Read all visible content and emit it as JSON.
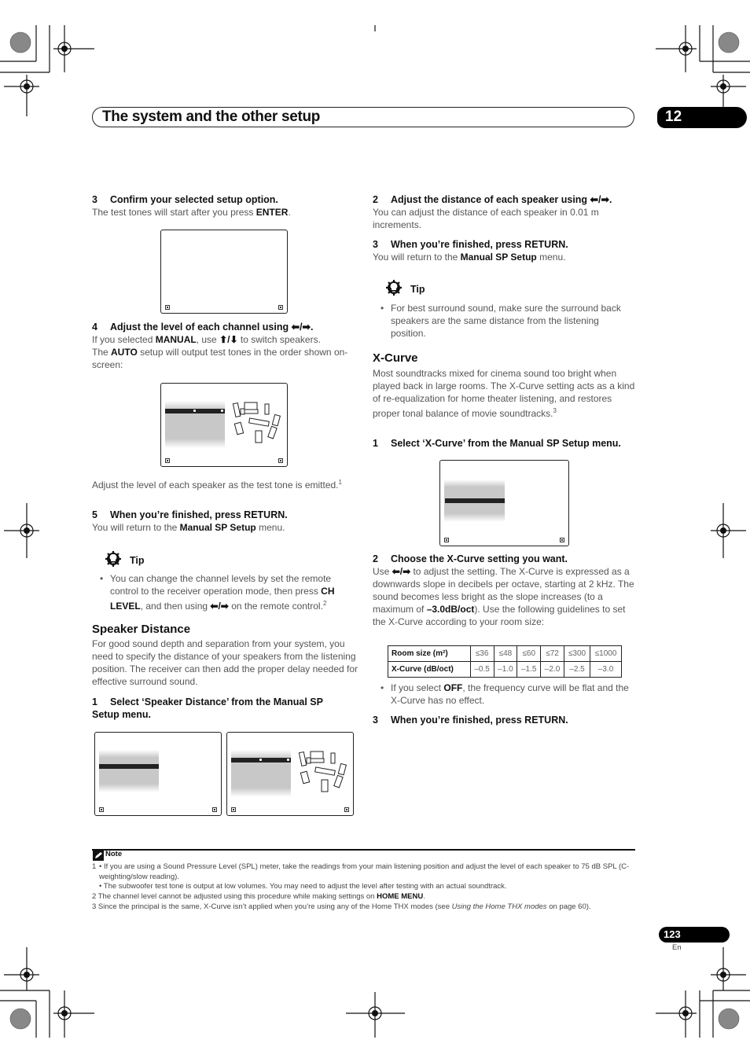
{
  "header": {
    "title": "The system and the other setup",
    "chapter_number": "12"
  },
  "left_column": {
    "step3": {
      "num": "3",
      "title": "Confirm your selected setup option.",
      "body_pre": "The test tones will start after you press ",
      "body_bold": "ENTER",
      "body_post": "."
    },
    "step4": {
      "num": "4",
      "title": "Adjust the level of each channel using ⬅/➡.",
      "line1_pre": "If you selected ",
      "line1_bold": "MANUAL",
      "line1_mid": ", use ",
      "line1_arrows": "⬆/⬇",
      "line1_post": " to switch speakers.",
      "line2_pre": "The ",
      "line2_bold": "AUTO",
      "line2_post": " setup will output test tones in the order shown on-screen:"
    },
    "adjust_text": "Adjust the level of each speaker as the test tone is emitted.",
    "adjust_sup": "1",
    "step5": {
      "num": "5",
      "title": "When you’re finished, press RETURN.",
      "body_pre": "You will return to the ",
      "body_bold": "Manual SP Setup",
      "body_post": " menu."
    },
    "tip": {
      "label": "Tip",
      "bullet": "•",
      "text_pre": "You can change the channel levels by set the remote control to the receiver operation mode, then press ",
      "text_bold1": "CH LEVEL",
      "text_mid": ", and then using ",
      "text_arrows": "⬅/➡",
      "text_post": " on the remote control.",
      "sup": "2"
    },
    "speaker_distance": {
      "heading": "Speaker Distance",
      "body": "For good sound depth and separation from your system, you need to specify the distance of your speakers from the listening position. The receiver can then add the proper delay needed for effective surround sound.",
      "step1_num": "1",
      "step1_title": "Select ‘Speaker Distance’ from the Manual SP Setup menu."
    }
  },
  "right_column": {
    "step2": {
      "num": "2",
      "title": "Adjust the distance of each speaker using ⬅/➡.",
      "body": "You can adjust the distance of each speaker in 0.01 m increments."
    },
    "step3": {
      "num": "3",
      "title": "When you’re finished, press RETURN.",
      "body_pre": "You will return to the ",
      "body_bold": "Manual SP Setup",
      "body_post": " menu."
    },
    "tip": {
      "label": "Tip",
      "bullet": "•",
      "text": "For best surround sound, make sure the surround back speakers are the same distance from the listening position."
    },
    "xcurve": {
      "heading": "X-Curve",
      "body": "Most soundtracks mixed for cinema sound too bright when played back in large rooms. The X-Curve setting acts as a kind of re-equalization for home theater listening, and restores proper tonal balance of movie soundtracks.",
      "sup": "3",
      "step1_num": "1",
      "step1_title": "Select ‘X-Curve’ from the Manual SP Setup menu.",
      "step2_num": "2",
      "step2_title": "Choose the X-Curve setting you want.",
      "step2_pre": "Use ",
      "step2_arrows": "⬅/➡",
      "step2_mid": " to adjust the setting. The X-Curve is expressed as a downwards slope in decibels per octave, starting at 2 kHz. The sound becomes less bright as the slope increases (to a maximum of ",
      "step2_bold": "–3.0dB/oct",
      "step2_post": "). Use the following guidelines to set the X-Curve according to your room size:",
      "table": {
        "row1_header": "Room size (m²)",
        "row1": [
          "≤36",
          "≤48",
          "≤60",
          "≤72",
          "≤300",
          "≤1000"
        ],
        "row2_header": "X-Curve (dB/oct)",
        "row2": [
          "–0.5",
          "–1.0",
          "–1.5",
          "–2.0",
          "–2.5",
          "–3.0"
        ]
      },
      "off_bullet": "•",
      "off_pre": "If you select ",
      "off_bold": "OFF",
      "off_post": ", the frequency curve will be flat and the X-Curve has no effect.",
      "step3_num": "3",
      "step3_title": "When you’re finished, press RETURN."
    }
  },
  "notes": {
    "label": "Note",
    "n1_num": "1",
    "n1a": "• If you are using a Sound Pressure Level (SPL) meter, take the readings from your main listening position and adjust the level of each speaker to 75 dB SPL (C-weighting/slow reading).",
    "n1b": "• The subwoofer test tone is output at low volumes. You may need to adjust the level after testing with an actual soundtrack.",
    "n2_pre": "2 The channel level cannot be adjusted using this procedure while making settings on ",
    "n2_bold": "HOME MENU",
    "n2_post": ".",
    "n3_pre": "3 Since the principal is the same, X-Curve isn’t applied when you’re using any of the Home THX modes (see ",
    "n3_italic": "Using the Home THX modes",
    "n3_post": " on page 60)."
  },
  "footer": {
    "page_number": "123",
    "language": "En"
  }
}
